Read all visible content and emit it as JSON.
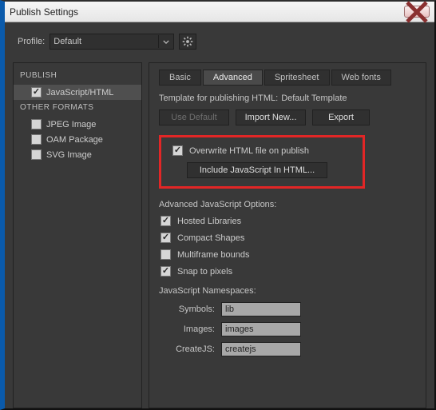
{
  "window": {
    "title": "Publish Settings"
  },
  "profile": {
    "label": "Profile:",
    "value": "Default"
  },
  "sidebar": {
    "heading_publish": "PUBLISH",
    "heading_other": "OTHER FORMATS",
    "items": [
      {
        "label": "JavaScript/HTML",
        "checked": true,
        "selected": true
      },
      {
        "label": "JPEG Image",
        "checked": false,
        "selected": false
      },
      {
        "label": "OAM Package",
        "checked": false,
        "selected": false
      },
      {
        "label": "SVG Image",
        "checked": false,
        "selected": false
      }
    ]
  },
  "tabs": {
    "items": [
      {
        "label": "Basic",
        "active": false
      },
      {
        "label": "Advanced",
        "active": true
      },
      {
        "label": "Spritesheet",
        "active": false
      },
      {
        "label": "Web fonts",
        "active": false
      }
    ]
  },
  "template": {
    "label": "Template for publishing HTML:",
    "value": "Default Template",
    "buttons": {
      "use_default": "Use Default",
      "import_new": "Import New...",
      "export": "Export"
    }
  },
  "overwrite": {
    "label": "Overwrite HTML file on publish",
    "checked": true,
    "include_btn": "Include JavaScript In HTML..."
  },
  "adv_js": {
    "heading": "Advanced JavaScript Options:",
    "hosted": {
      "label": "Hosted Libraries",
      "checked": true
    },
    "compact": {
      "label": "Compact Shapes",
      "checked": true
    },
    "multiframe": {
      "label": "Multiframe bounds",
      "checked": false
    },
    "snap": {
      "label": "Snap to pixels",
      "checked": true
    }
  },
  "namespaces": {
    "heading": "JavaScript Namespaces:",
    "symbols_label": "Symbols:",
    "symbols_value": "lib",
    "images_label": "Images:",
    "images_value": "images",
    "createjs_label": "CreateJS:",
    "createjs_value": "createjs"
  }
}
